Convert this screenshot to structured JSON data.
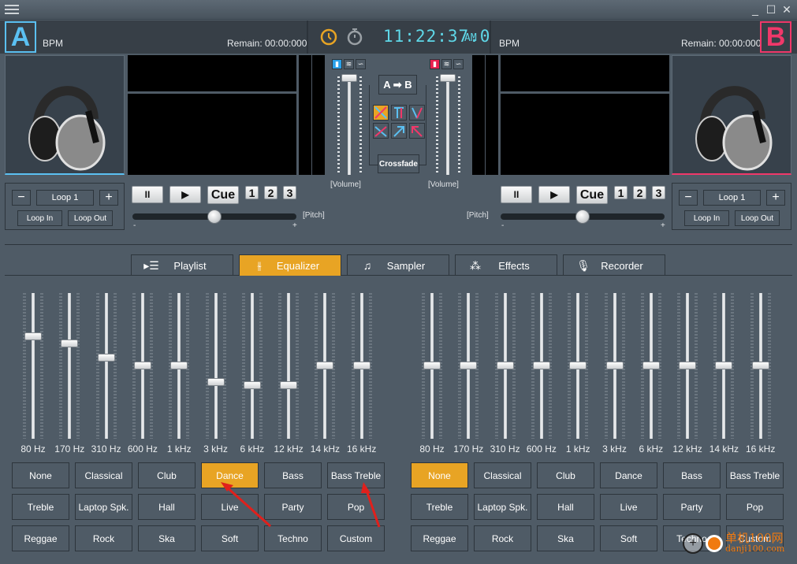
{
  "window": {
    "controls": [
      "minimize",
      "maximize",
      "close"
    ]
  },
  "deckA": {
    "letter": "A",
    "color": "#5bc0f2",
    "bpm_label": "BPM",
    "remain": "Remain: 00:00:000",
    "loop_label": "Loop 1",
    "loop_minus": "−",
    "loop_plus": "+",
    "loop_in": "Loop In",
    "loop_out": "Loop Out",
    "pause": "II",
    "play": "▶",
    "cue": "Cue",
    "hotcues": [
      "1",
      "2",
      "3"
    ],
    "pitch_label": "[Pitch]",
    "pitch_min": "-",
    "pitch_max": "+",
    "pitch_value": 0.5
  },
  "deckB": {
    "letter": "B",
    "color": "#f0386a",
    "bpm_label": "BPM",
    "remain": "Remain: 00:00:000",
    "loop_label": "Loop 1",
    "loop_minus": "−",
    "loop_plus": "+",
    "loop_in": "Loop In",
    "loop_out": "Loop Out",
    "pause": "II",
    "play": "▶",
    "cue": "Cue",
    "hotcues": [
      "1",
      "2",
      "3"
    ],
    "pitch_label": "[Pitch]",
    "pitch_min": "-",
    "pitch_max": "+",
    "pitch_value": 0.5
  },
  "clock": {
    "time": "11:22:37.0",
    "ampm": "AM",
    "accent": "#e8a424"
  },
  "mixer": {
    "ab_label": "A ➡ B",
    "crossfade_label": "Crossfade",
    "volume_label_left": "[Volume]",
    "volume_label_right": "[Volume]",
    "volume_left": 1.0,
    "volume_right": 1.0
  },
  "tabs": [
    {
      "label": "Playlist",
      "icon": "playlist-icon",
      "active": false
    },
    {
      "label": "Equalizer",
      "icon": "equalizer-icon",
      "active": true
    },
    {
      "label": "Sampler",
      "icon": "music-note-icon",
      "active": false
    },
    {
      "label": "Effects",
      "icon": "stars-icon",
      "active": false
    },
    {
      "label": "Recorder",
      "icon": "microphone-icon",
      "active": false
    }
  ],
  "eq": {
    "bands": [
      "80 Hz",
      "170 Hz",
      "310 Hz",
      "600 Hz",
      "1 kHz",
      "3 kHz",
      "6 kHz",
      "12 kHz",
      "14 kHz",
      "16 kHz"
    ],
    "left_levels": [
      0.7,
      0.65,
      0.55,
      0.5,
      0.5,
      0.38,
      0.36,
      0.36,
      0.5,
      0.5
    ],
    "right_levels": [
      0.5,
      0.5,
      0.5,
      0.5,
      0.5,
      0.5,
      0.5,
      0.5,
      0.5,
      0.5
    ],
    "presets": [
      "None",
      "Classical",
      "Club",
      "Dance",
      "Bass",
      "Bass Treble",
      "Treble",
      "Laptop Spk.",
      "Hall",
      "Live",
      "Party",
      "Pop",
      "Reggae",
      "Rock",
      "Ska",
      "Soft",
      "Techno",
      "Custom"
    ],
    "left_active": "Dance",
    "right_active": "None",
    "active_color": "#e8a424"
  },
  "watermark": {
    "text": "单机100网",
    "sub": "danji100.com"
  }
}
